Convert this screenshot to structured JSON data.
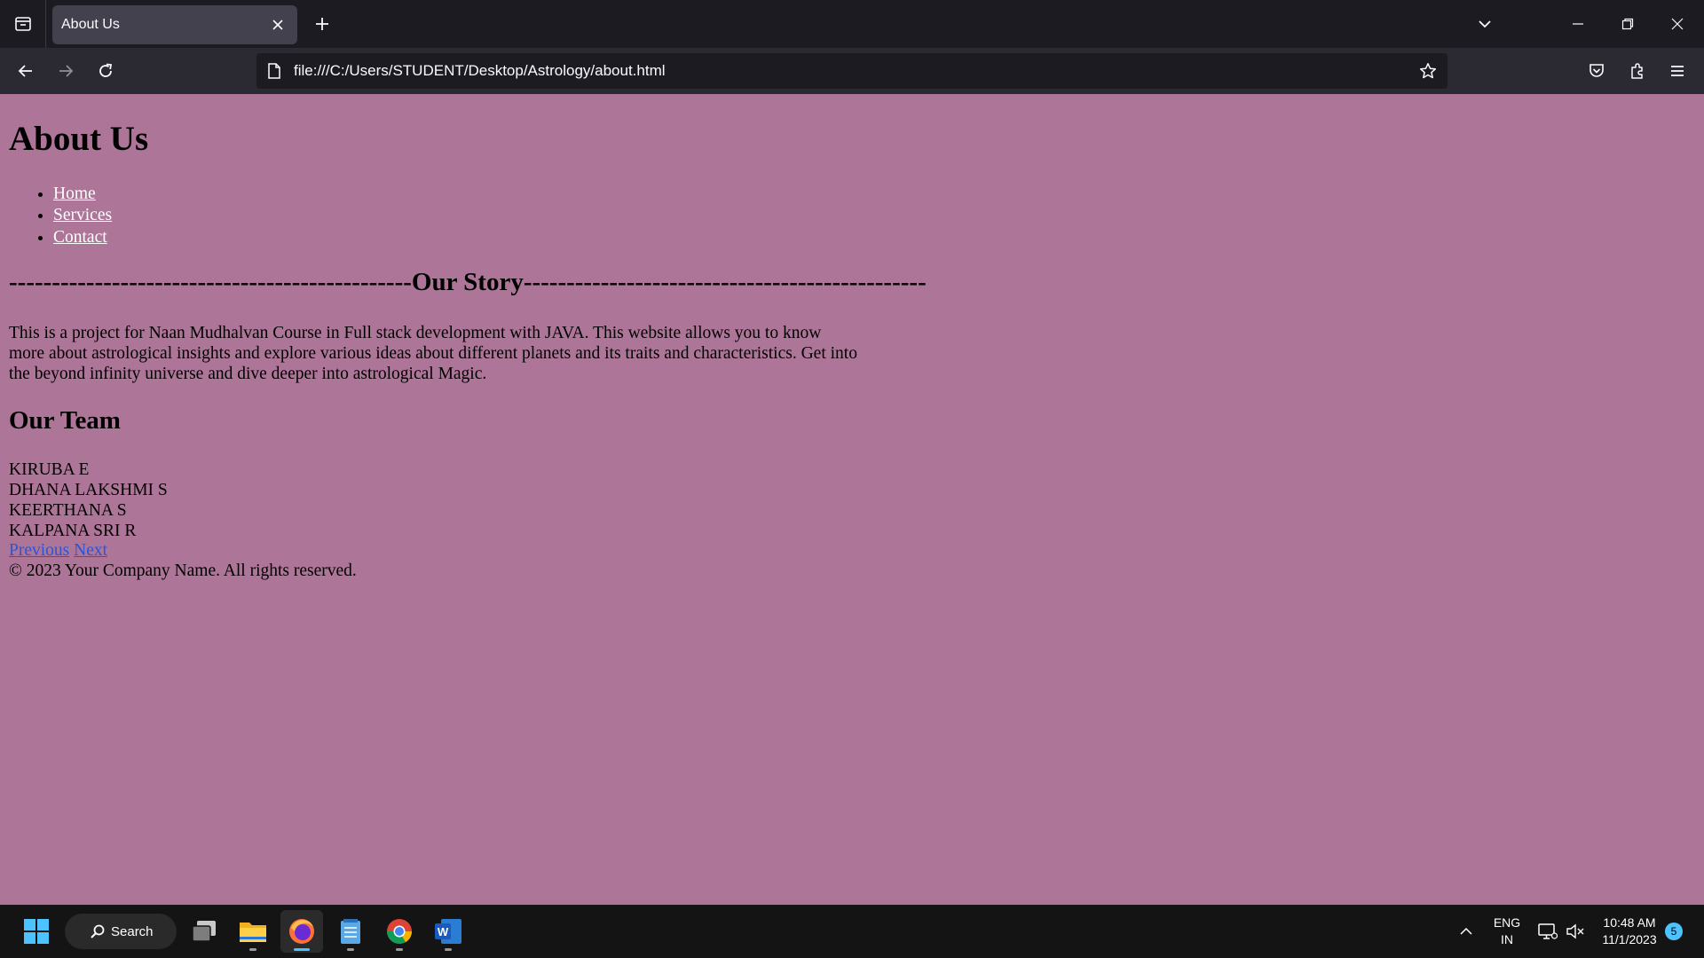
{
  "browser": {
    "tab_title": "About Us",
    "url": "file:///C:/Users/STUDENT/Desktop/Astrology/about.html"
  },
  "page": {
    "title": "About Us",
    "nav_links": [
      "Home",
      "Services",
      "Contact"
    ],
    "story_heading": "-----------------------------------------------Our Story-----------------------------------------------",
    "story_text": "This is a project for Naan Mudhalvan Course in Full stack development with JAVA. This website allows you to know more about astrological insights and explore various ideas about different planets and its traits and characteristics. Get into the beyond infinity universe and dive deeper into astrological Magic.",
    "team_heading": "Our Team",
    "team_members": [
      "KIRUBA E",
      "DHANA LAKSHMI S",
      "KEERTHANA S",
      "KALPANA SRI R"
    ],
    "pager_previous": "Previous",
    "pager_next": "Next",
    "footer": "© 2023 Your Company Name. All rights reserved.",
    "background_color": "#ad7597"
  },
  "taskbar": {
    "search_label": "Search",
    "language_line1": "ENG",
    "language_line2": "IN",
    "time": "10:48 AM",
    "date": "11/1/2023",
    "notification_count": "5"
  }
}
